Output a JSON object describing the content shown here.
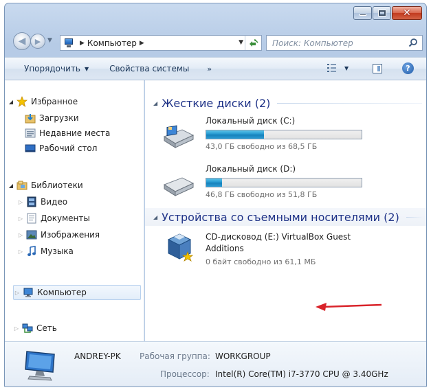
{
  "address": {
    "crumbs": [
      "Компьютер"
    ],
    "search_placeholder": "Поиск: Компьютер"
  },
  "toolbar": {
    "organize": "Упорядочить",
    "system_properties": "Свойства системы",
    "more": "»"
  },
  "nav": {
    "favorites": "Избранное",
    "downloads": "Загрузки",
    "recent": "Недавние места",
    "desktop": "Рабочий стол",
    "libraries": "Библиотеки",
    "video": "Видео",
    "documents": "Документы",
    "pictures": "Изображения",
    "music": "Музыка",
    "computer": "Компьютер",
    "network": "Сеть"
  },
  "groups": {
    "hard_drives": "Жесткие диски (2)",
    "removable": "Устройства со съемными носителями (2)"
  },
  "drives": [
    {
      "name": "Локальный диск (C:)",
      "free": "43,0 ГБ свободно из 68,5 ГБ",
      "used_fraction": 0.37
    },
    {
      "name": "Локальный диск (D:)",
      "free": "46,8 ГБ свободно из 51,8 ГБ",
      "used_fraction": 0.1
    }
  ],
  "cd": {
    "name": "CD-дисковод (E:) VirtualBox Guest Additions",
    "free": "0 байт свободно из 61,1 МБ"
  },
  "details": {
    "pc_name": "ANDREY-PK",
    "workgroup_label": "Рабочая группа:",
    "workgroup_value": "WORKGROUP",
    "cpu_label": "Процессор:",
    "cpu_value": "Intel(R) Core(TM) i7-3770 CPU @ 3.40GHz"
  },
  "colors": {
    "annotation_arrow": "#d9232a",
    "drive_bar": "#1f93cd"
  }
}
